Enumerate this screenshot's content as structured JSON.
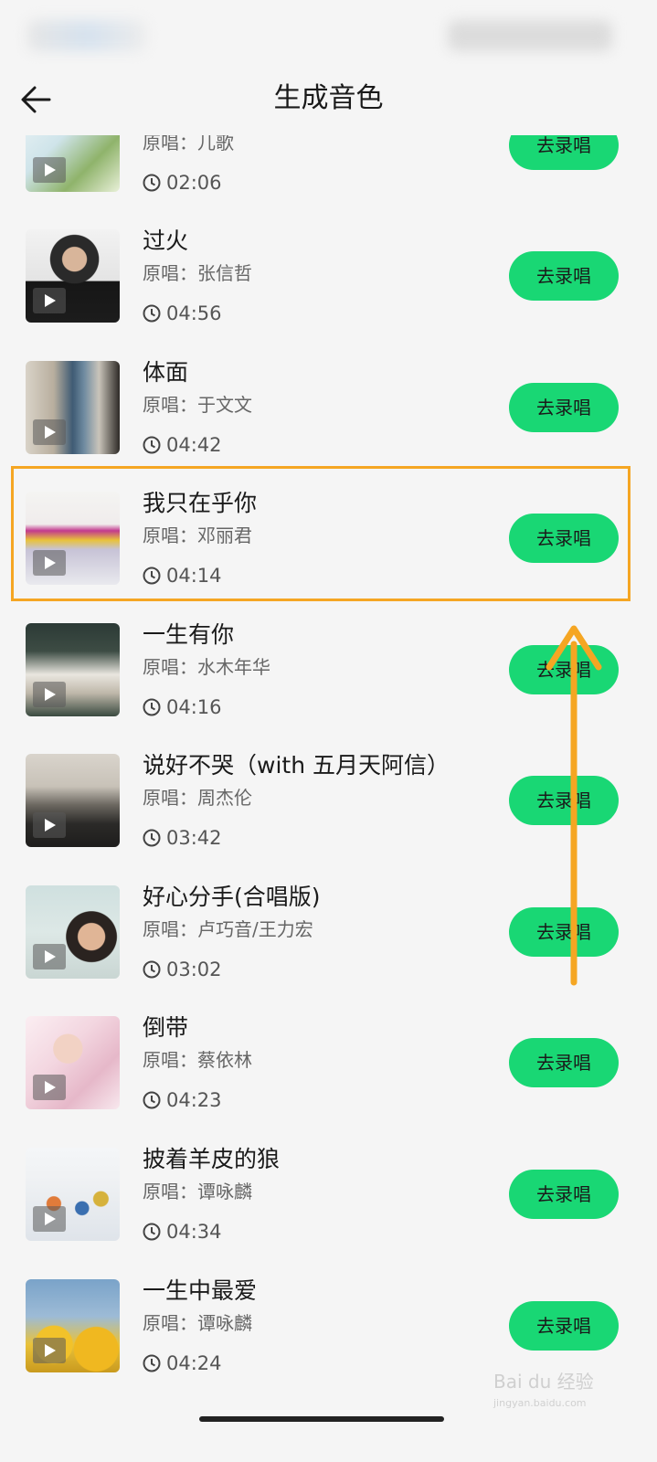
{
  "header": {
    "title": "生成音色"
  },
  "accent_color": "#19d774",
  "highlight_color": "#f5a623",
  "record_label": "去录唱",
  "artist_prefix": "原唱：",
  "songs": [
    {
      "title": "",
      "artist": "原唱：儿歌",
      "duration": "02:06"
    },
    {
      "title": "过火",
      "artist": "原唱：张信哲",
      "duration": "04:56"
    },
    {
      "title": "体面",
      "artist": "原唱：于文文",
      "duration": "04:42"
    },
    {
      "title": "我只在乎你",
      "artist": "原唱：邓丽君",
      "duration": "04:14"
    },
    {
      "title": "一生有你",
      "artist": "原唱：水木年华",
      "duration": "04:16"
    },
    {
      "title": "说好不哭（with 五月天阿信）",
      "artist": "原唱：周杰伦",
      "duration": "03:42"
    },
    {
      "title": "好心分手(合唱版)",
      "artist": "原唱：卢巧音/王力宏",
      "duration": "03:02"
    },
    {
      "title": "倒带",
      "artist": "原唱：蔡依林",
      "duration": "04:23"
    },
    {
      "title": "披着羊皮的狼",
      "artist": "原唱：谭咏麟",
      "duration": "04:34"
    },
    {
      "title": "一生中最爱",
      "artist": "原唱：谭咏麟",
      "duration": "04:24"
    }
  ],
  "watermark": {
    "text": "Bai du 经验",
    "sub": "jingyan.baidu.com"
  }
}
